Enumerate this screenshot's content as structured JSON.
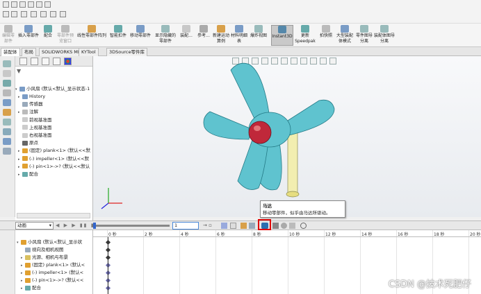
{
  "ribbon": {
    "items": [
      {
        "label": "编辑零部件",
        "disabled": true
      },
      {
        "label": "插入零部件"
      },
      {
        "label": "配合"
      },
      {
        "label": "零部件预览窗口",
        "disabled": true
      },
      {
        "label": "线性零部件阵列"
      },
      {
        "label": "智能扣件"
      },
      {
        "label": "移动零部件"
      },
      {
        "label": "显示隐藏的零部件"
      },
      {
        "label": "装配..."
      },
      {
        "label": "参考..."
      },
      {
        "label": "新建运动算例"
      },
      {
        "label": "材料明细表"
      },
      {
        "label": "爆炸视图"
      },
      {
        "label": "Instant3D",
        "active": true
      },
      {
        "label": "更新Speedpak"
      },
      {
        "label": "拍快照"
      },
      {
        "label": "大型装配体模式"
      },
      {
        "label": "零件图导分离"
      },
      {
        "label": "装配体图导分离"
      }
    ]
  },
  "tabs": [
    "装配体",
    "布局",
    "SOLIDWORKS MBD",
    "KYTool",
    "3DSource零件库"
  ],
  "tree": {
    "root": "小风扇 (默认<默认_显示状态-1",
    "items": [
      {
        "label": "History",
        "icon": "history-icon"
      },
      {
        "label": "传感器",
        "icon": "sensor-icon"
      },
      {
        "label": "注解",
        "icon": "annotation-icon"
      },
      {
        "label": "前视基准面",
        "icon": "plane-icon"
      },
      {
        "label": "上视基准面",
        "icon": "plane-icon"
      },
      {
        "label": "右视基准面",
        "icon": "plane-icon"
      },
      {
        "label": "原点",
        "icon": "origin-icon"
      },
      {
        "label": "(固定) plank<1> (默认<<默",
        "icon": "part-icon"
      },
      {
        "label": "(-) impeller<1> (默认<<默",
        "icon": "part-icon"
      },
      {
        "label": "(-) pin<1>->? (默认<<默认",
        "icon": "part-icon"
      },
      {
        "label": "配合",
        "icon": "mate-icon"
      }
    ]
  },
  "anim": {
    "study_type": "动画",
    "zoom_value": "1",
    "tooltip_title": "马达",
    "tooltip_desc": "移动零部件，似乎由马达所驱动。"
  },
  "timeline": {
    "tree": [
      {
        "label": "小风扇 (默认<默认_显示状"
      },
      {
        "label": "视向及相机视图"
      },
      {
        "label": "光源、相机与布景"
      },
      {
        "label": "(固定) plank<1> (默认<"
      },
      {
        "label": "(-) impeller<1> (默认<"
      },
      {
        "label": "(-) pin<1>->? (默认<<"
      },
      {
        "label": "配合"
      }
    ],
    "ticks": [
      "0 秒",
      "2 秒",
      "4 秒",
      "6 秒",
      "8 秒",
      "10 秒",
      "12 秒",
      "14 秒",
      "16 秒",
      "18 秒",
      "20 秒"
    ]
  },
  "watermark": "CSDN @技术死肥仔",
  "colors": {
    "impeller": "#5fc3cf",
    "hub": "#c0283a",
    "pin": "#f4f0a0",
    "highlight": "#e00000"
  }
}
